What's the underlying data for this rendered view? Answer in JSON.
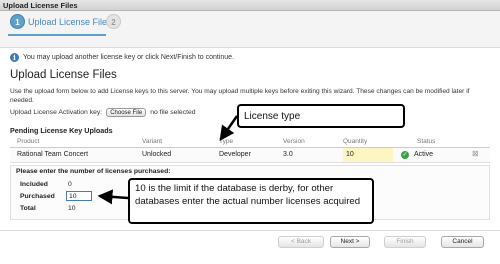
{
  "window": {
    "title": "Upload License Files"
  },
  "wizard": {
    "steps": [
      {
        "number": "1",
        "label": "Upload License Files"
      },
      {
        "number": "2",
        "label": ""
      }
    ]
  },
  "info": {
    "icon": "info-icon",
    "glyph": "i",
    "text": "You may upload another license key or click Next/Finish to continue."
  },
  "page": {
    "title": "Upload License Files",
    "description": "Use the upload form below to add License keys to this server. You may upload multiple keys before exiting this wizard. These changes can be modified later if needed.",
    "key_label": "Upload License Activation key:",
    "choose_button": "Choose File",
    "file_status": "no file selected"
  },
  "pending": {
    "title": "Pending License Key Uploads",
    "headers": [
      "Product",
      "Variant",
      "Type",
      "Version",
      "Quantity",
      "Status"
    ],
    "row": {
      "product": "Rational Team Concert",
      "variant": "Unlocked",
      "type": "Developer",
      "version": "3.0",
      "quantity": "10",
      "status_icon": "check-icon",
      "status_glyph": "✓",
      "status": "Active",
      "remove_glyph": "⊠"
    }
  },
  "licenses": {
    "prompt": "Please enter the number of licenses purchased:",
    "included_label": "Included",
    "included_value": "0",
    "purchased_label": "Purchased",
    "purchased_value": "10",
    "total_label": "Total",
    "total_value": "10"
  },
  "buttons": {
    "back": "< Back",
    "next": "Next >",
    "finish": "Finish",
    "cancel": "Cancel"
  },
  "annotations": {
    "license_type": "License type",
    "limit_note": "10 is the limit if the database is derby, for other databases enter the actual number licenses acquired"
  },
  "colors": {
    "accent": "#5f9fcc",
    "quantity_highlight": "#fdf6c3",
    "status_active": "#37a443"
  }
}
